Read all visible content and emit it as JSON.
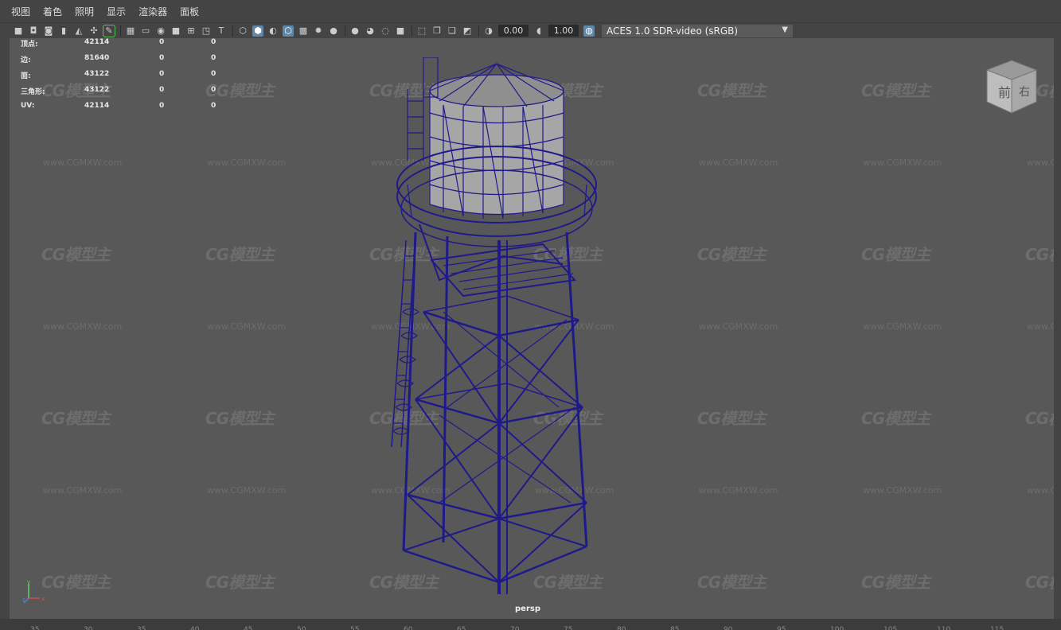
{
  "menu": [
    "视图",
    "着色",
    "照明",
    "显示",
    "渲染器",
    "面板"
  ],
  "toolbar": {
    "exposure": "0.00",
    "gamma": "1.00",
    "color_space": "ACES 1.0 SDR-video (sRGB)"
  },
  "stats": [
    {
      "label": "顶点:",
      "v1": "42114",
      "v2": "0",
      "v3": "0"
    },
    {
      "label": "边:",
      "v1": "81640",
      "v2": "0",
      "v3": "0"
    },
    {
      "label": "面:",
      "v1": "43122",
      "v2": "0",
      "v3": "0"
    },
    {
      "label": "三角形:",
      "v1": "43122",
      "v2": "0",
      "v3": "0"
    },
    {
      "label": "UV:",
      "v1": "42114",
      "v2": "0",
      "v3": "0"
    }
  ],
  "viewcube": {
    "front": "前",
    "right": "右"
  },
  "camera_label": "persp",
  "watermark": {
    "logo": "CG模型主",
    "url": "www.CGMXW.com"
  },
  "axis": {
    "x": "x",
    "y": "y",
    "z": "z"
  },
  "ruler_ticks": [
    "35",
    "30",
    "35",
    "40",
    "45",
    "50",
    "55",
    "60",
    "65",
    "70",
    "75",
    "80",
    "85",
    "90",
    "95",
    "100",
    "105",
    "110",
    "115"
  ],
  "colors": {
    "wireframe": "#1f1a8a",
    "viewport_bg": "#585858",
    "accent": "#5e87a8"
  }
}
